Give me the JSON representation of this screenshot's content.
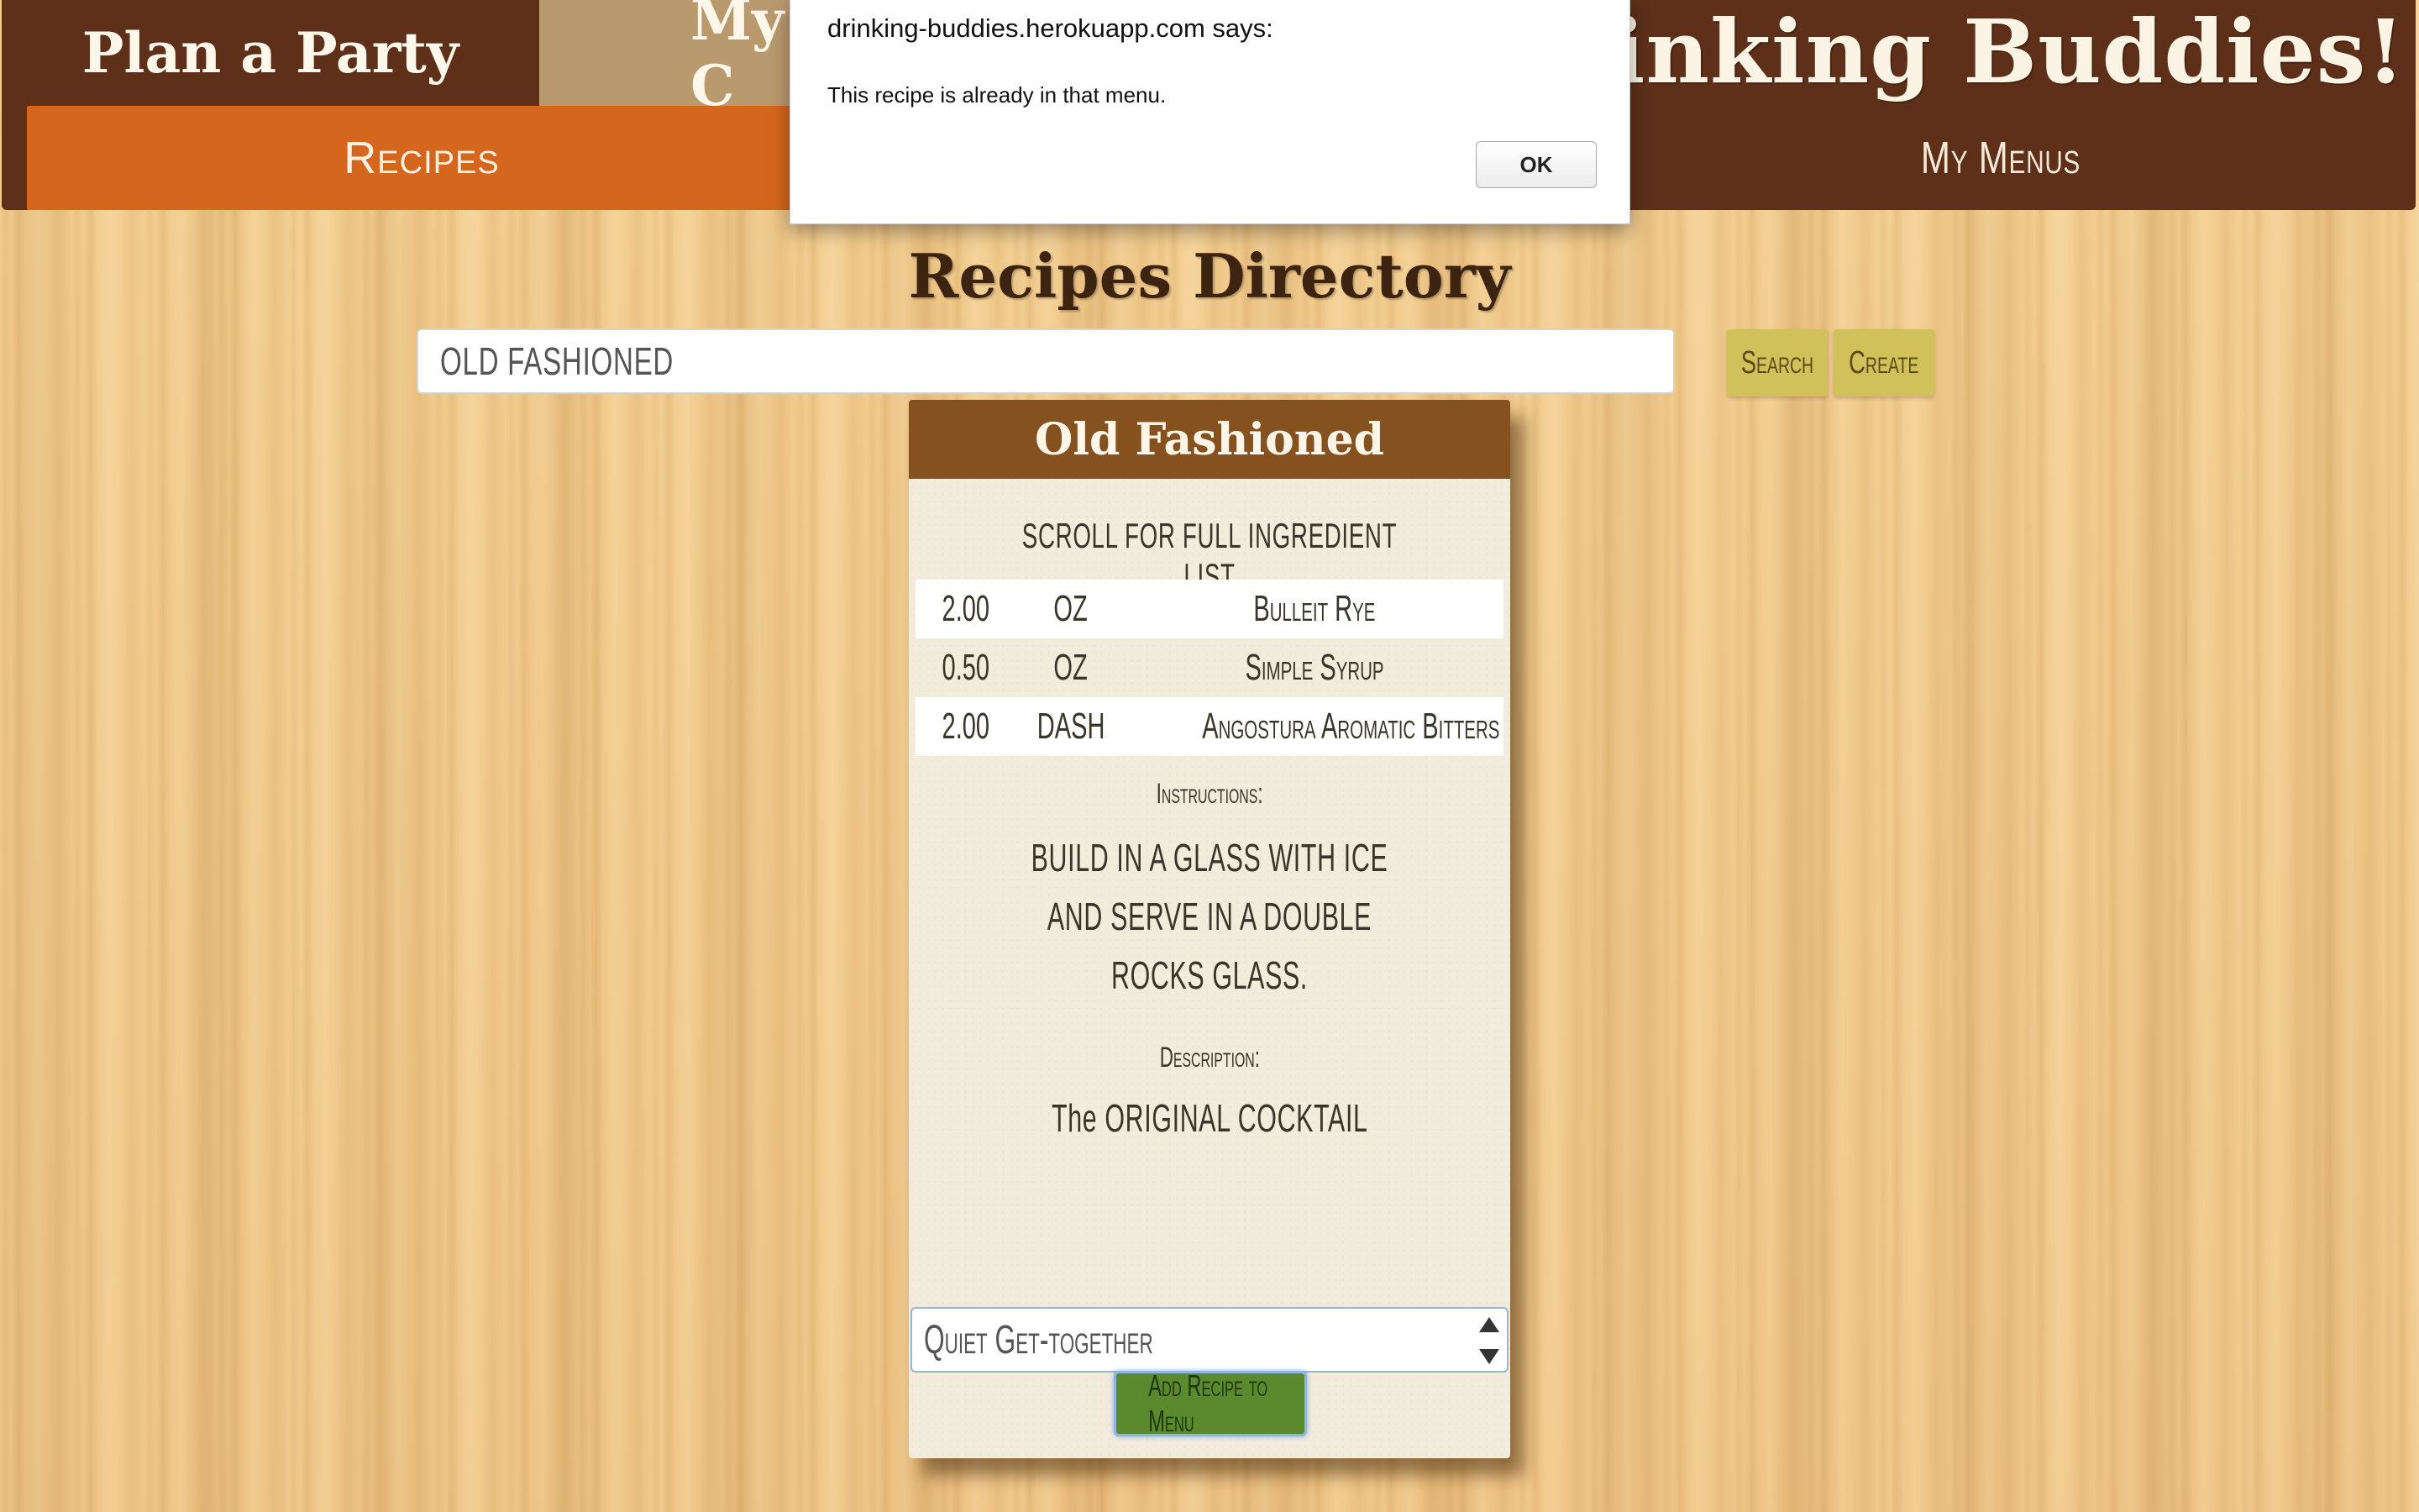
{
  "header": {
    "tab_plan": "Plan a Party",
    "tab_my": "My C",
    "brand": "Drinking Buddies!",
    "nav_recipes": "Recipes",
    "nav_menus": "My Menus"
  },
  "alert": {
    "title": "drinking-buddies.herokuapp.com says:",
    "message": "This recipe is already in that menu.",
    "ok_label": "OK"
  },
  "main": {
    "title": "Recipes Directory",
    "search_value": "OLD FASHIONED",
    "search_label": "Search",
    "create_label": "Create"
  },
  "recipe": {
    "name": "Old Fashioned",
    "scroll_note": "SCROLL FOR FULL INGREDIENT LIST",
    "ingredients": [
      {
        "amount": "2.00",
        "unit": "OZ",
        "name": "Bulleit Rye"
      },
      {
        "amount": "0.50",
        "unit": "OZ",
        "name": "Simple Syrup"
      },
      {
        "amount": "2.00",
        "unit": "DASH",
        "name": "Angostura Aromatic Bitters"
      }
    ],
    "instructions_label": "Instructions:",
    "instructions": "BUILD IN A GLASS WITH ICE AND SERVE IN A DOUBLE ROCKS GLASS.",
    "description_label": "Description:",
    "description": "The ORIGINAL COCKTAIL",
    "menu_selected": "Quiet Get-together",
    "add_label": "Add Recipe to Menu"
  },
  "colors": {
    "header_brown": "#5e3019",
    "nav_orange": "#d4661e",
    "tab_tan": "#b99a6f",
    "card_header": "#85521f",
    "button_gold": "#d1c15a",
    "add_green": "#5b8a2e"
  }
}
